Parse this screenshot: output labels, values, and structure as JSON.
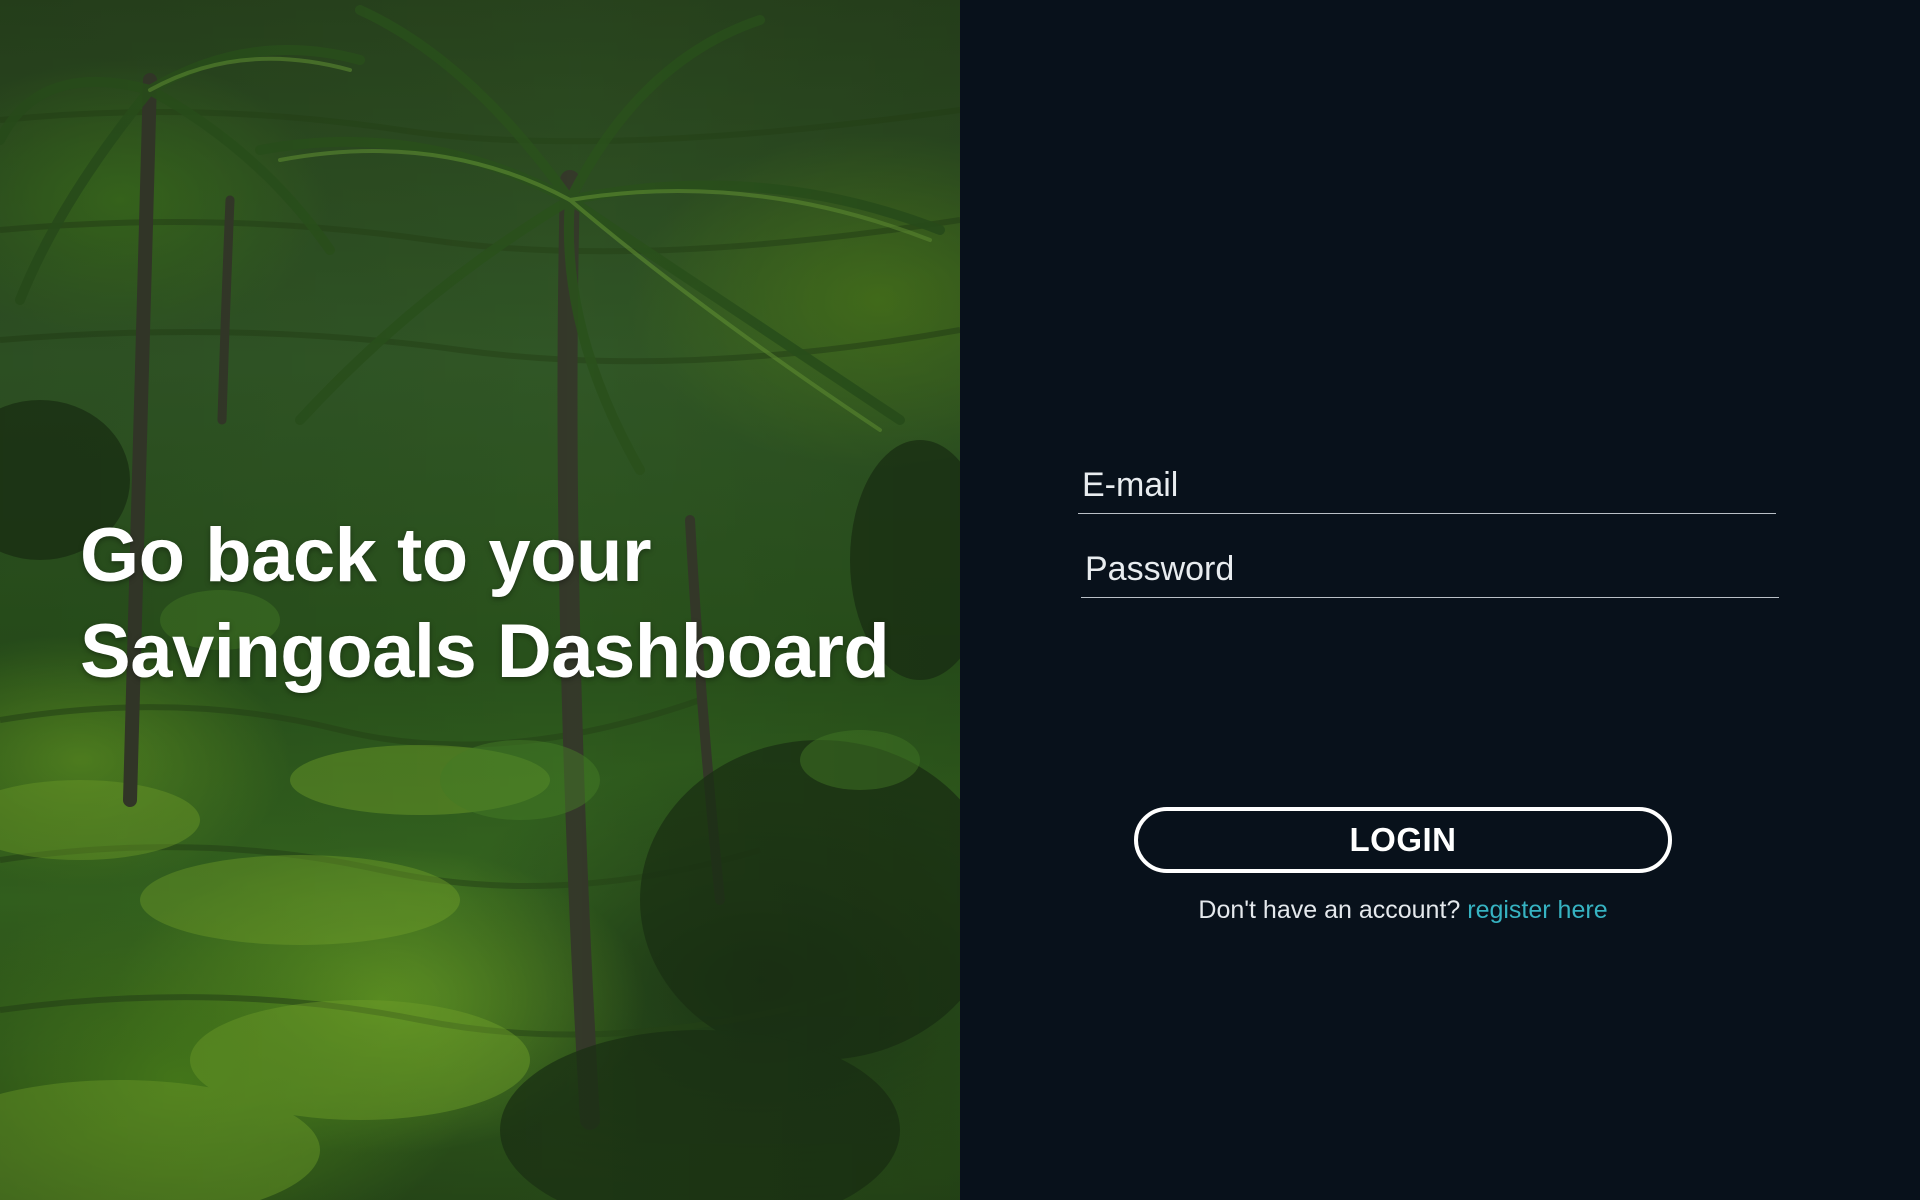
{
  "hero": {
    "title_line1": "Go back to your",
    "title_line2": "Savingoals Dashboard"
  },
  "form": {
    "email": {
      "placeholder": "E-mail",
      "value": ""
    },
    "password": {
      "placeholder": "Password",
      "value": ""
    },
    "login_label": "LOGIN",
    "register_prompt": "Don't have an account?",
    "register_link": "register here"
  },
  "colors": {
    "panel_background": "#08111b",
    "link": "#36b3c2",
    "button_border": "#ffffff"
  }
}
